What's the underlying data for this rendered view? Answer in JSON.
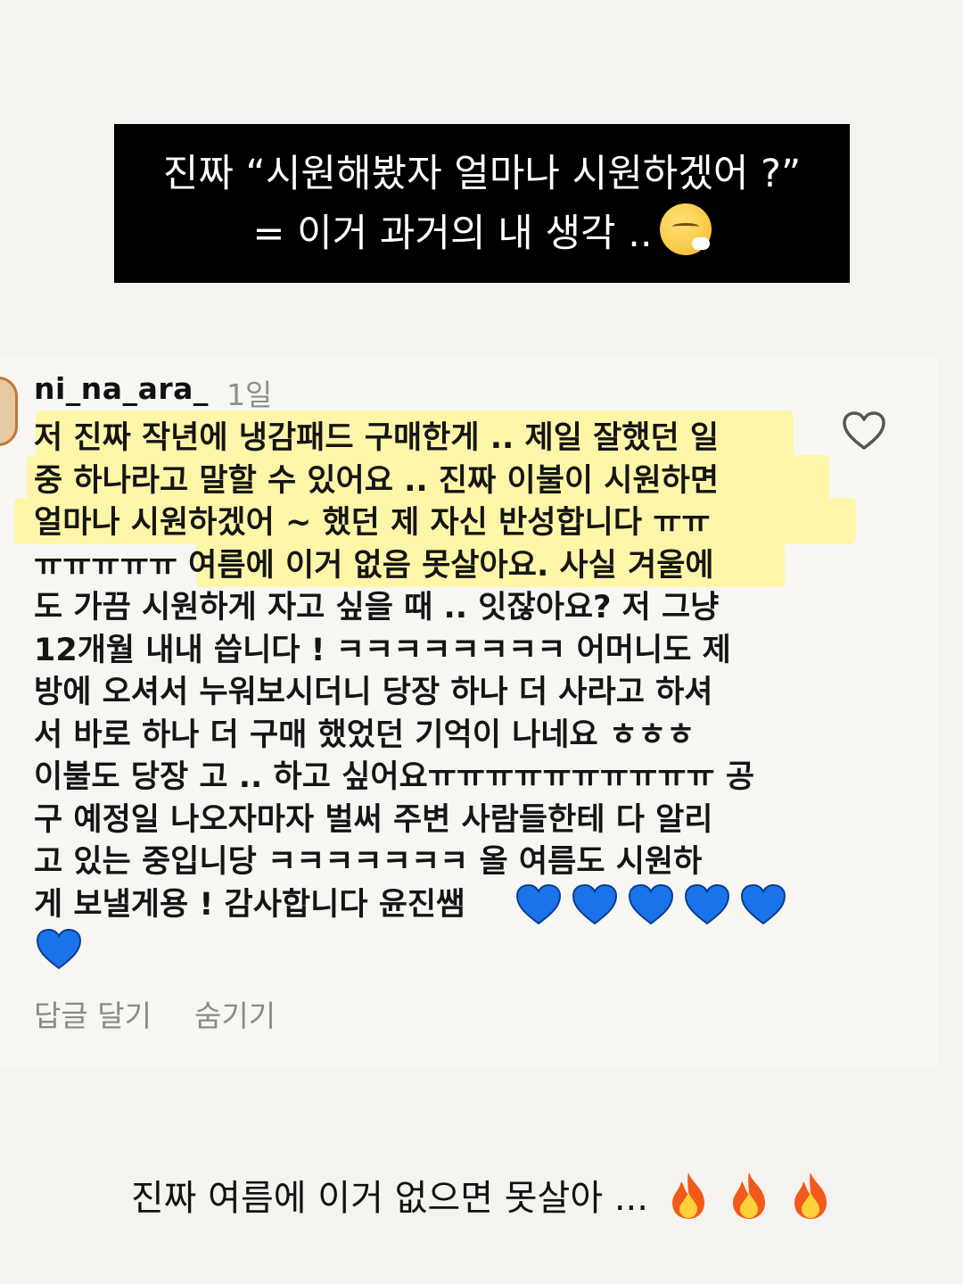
{
  "top_caption": {
    "line1": "진짜 “시원해봤자 얼마나 시원하겠어 ?”",
    "line2": "= 이거 과거의 내 생각 ..",
    "emoji": "face-exhaling-emoji"
  },
  "comment": {
    "username": "ni_na_ara_",
    "time": "1일",
    "text": "저 진짜 작년에 냉감패드 구매한게 .. 제일 잘했던 일\n중 하나라고 말할 수 있어요 .. 진짜 이불이 시원하면\n얼마나 시원하겠어 ~ 했던 제 자신 반성합니다 ㅠㅠ\nㅠㅠㅠㅠㅠ 여름에 이거 없음 못살아요. 사실 겨울에\n도 가끔 시원하게 자고 싶을 때 .. 잇잖아요? 저 그냥\n12개월 내내 씁니다 ! ㅋㅋㅋㅋㅋㅋㅋㅋ 어머니도 제\n방에 오셔서 누워보시더니 당장 하나 더 사라고 하셔\n서 바로 하나 더 구매 했었던 기억이 나네요 ㅎㅎㅎ\n이불도 당장 고 .. 하고 싶어요ㅠㅠㅠㅠㅠㅠㅠㅠㅠㅠ 공\n구 예정일 나오자마자 벌써 주변 사람들한테 다 알리\n고 있는 중입니당 ㅋㅋㅋㅋㅋㅋㅋ 올 여름도 시원하\n게 보낼게용 ! 감사합니다 윤진쌤",
    "heart_emoji_count": 6,
    "heart_color": "#1a73e8",
    "reply_label": "답글 달기",
    "hide_label": "숨기기",
    "like_icon": "heart-outline-icon",
    "highlight_color": "#fdf6a8"
  },
  "bottom_caption": {
    "text": "진짜 여름에 이거 없으면 못살아 ...",
    "emoji": "fire-emoji",
    "emoji_count": 3
  }
}
